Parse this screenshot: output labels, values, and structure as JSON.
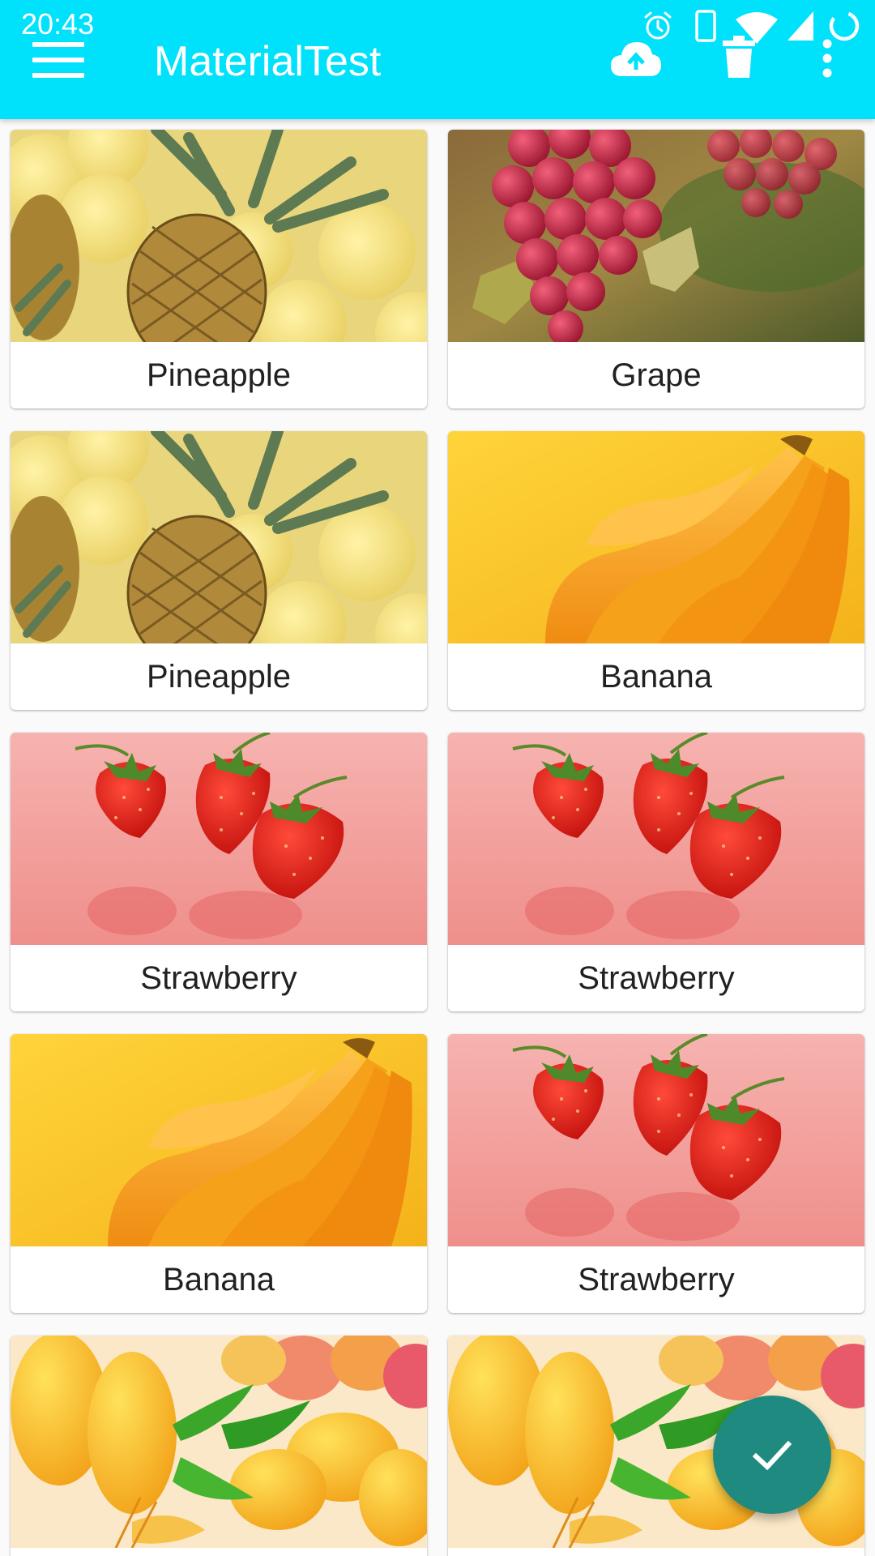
{
  "status_bar": {
    "time": "20:43",
    "icons": [
      "alarm-icon",
      "phone-icon",
      "wifi-icon",
      "cell-signal-icon",
      "battery-charging-icon"
    ]
  },
  "app_bar": {
    "title": "MaterialTest",
    "navigation_icon": "menu-icon",
    "actions": [
      "cloud-upload-icon",
      "delete-icon",
      "more-vert-icon"
    ]
  },
  "fruits": [
    {
      "name": "Pineapple",
      "image": "pineapple"
    },
    {
      "name": "Grape",
      "image": "grape"
    },
    {
      "name": "Pineapple",
      "image": "pineapple"
    },
    {
      "name": "Banana",
      "image": "banana"
    },
    {
      "name": "Strawberry",
      "image": "strawberry"
    },
    {
      "name": "Strawberry",
      "image": "strawberry"
    },
    {
      "name": "Banana",
      "image": "banana"
    },
    {
      "name": "Strawberry",
      "image": "strawberry"
    },
    {
      "name": "",
      "image": "mango"
    },
    {
      "name": "",
      "image": "mango"
    }
  ],
  "fab": {
    "icon": "check-icon"
  },
  "colors": {
    "app_bar": "#00e1fb",
    "fab": "#1e8a80",
    "background": "#fafafa",
    "label_text": "#212121"
  }
}
